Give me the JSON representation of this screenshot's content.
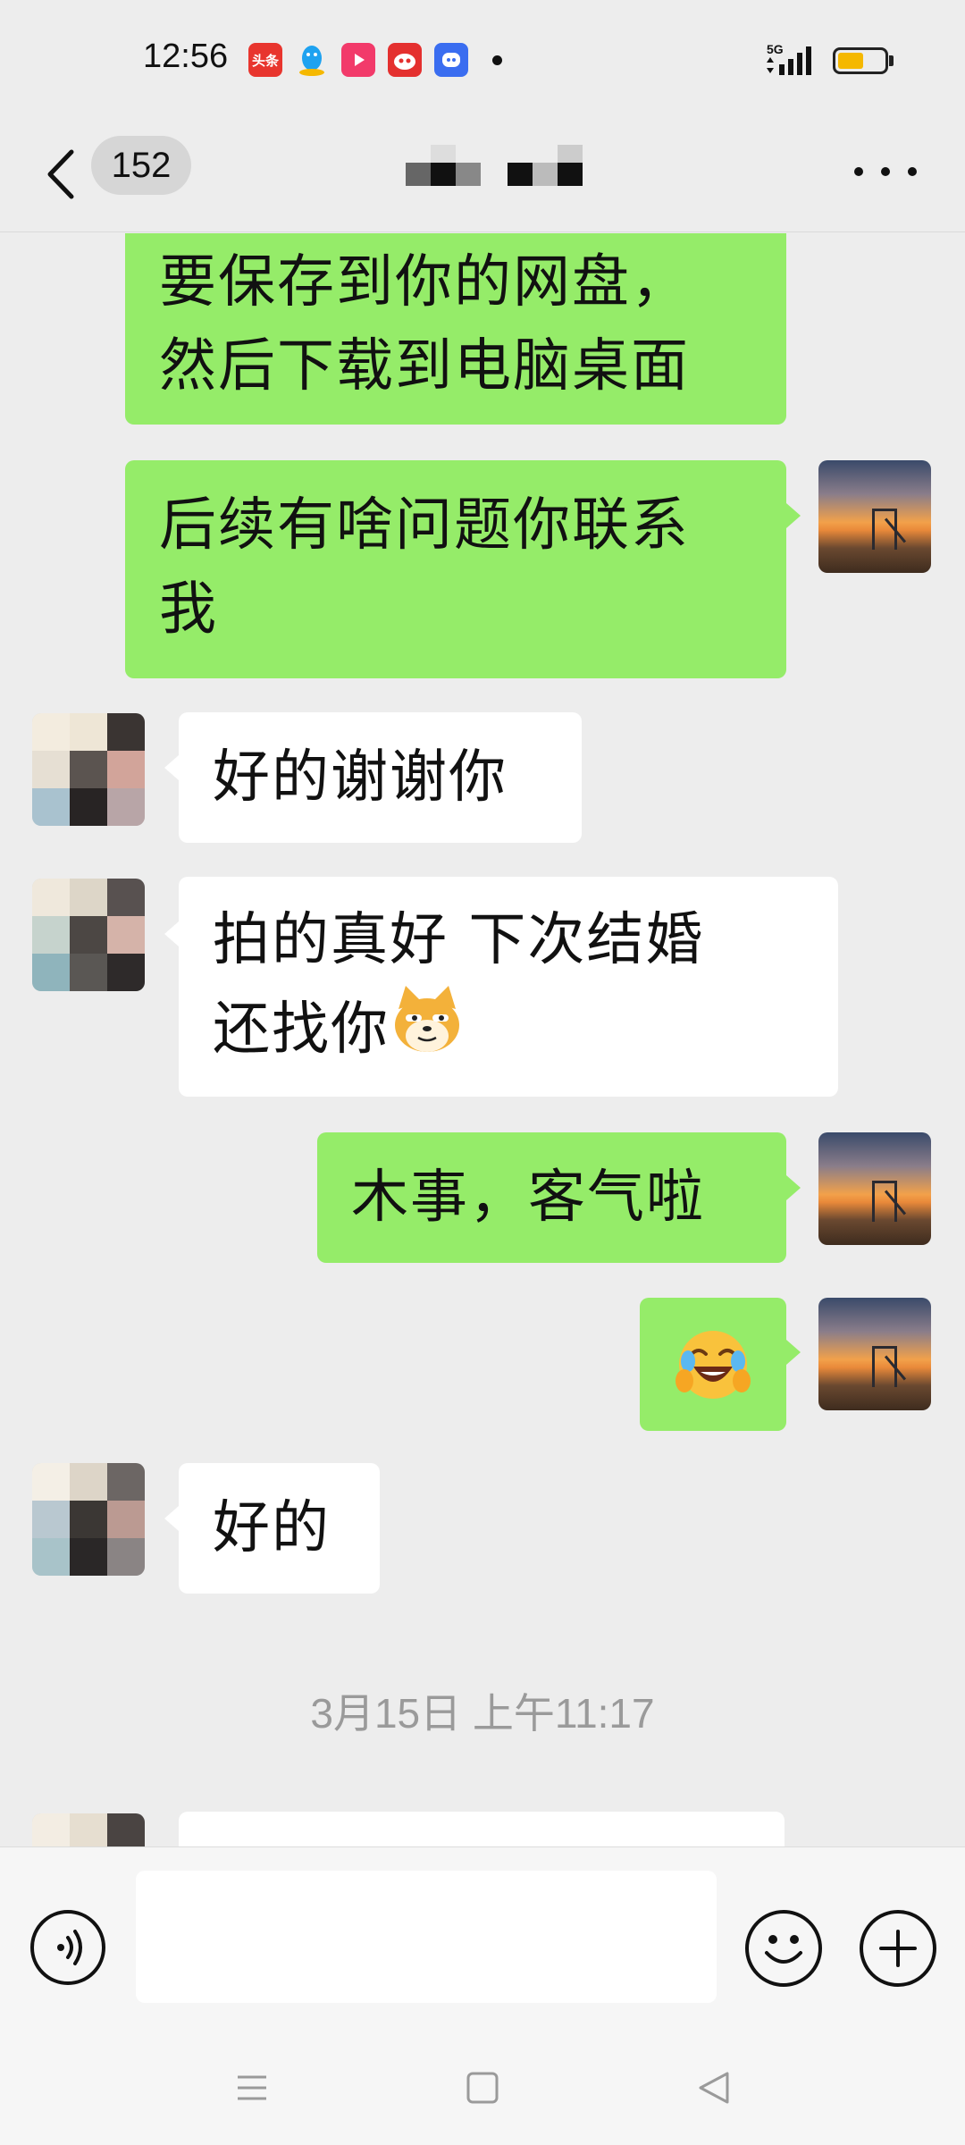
{
  "status_bar": {
    "time": "12:56",
    "app_icons": [
      {
        "name": "toutiao-icon",
        "label": "头条",
        "color": "#e8352e"
      },
      {
        "name": "qq-icon",
        "label": "",
        "color": "#1ea2f0"
      },
      {
        "name": "video-icon",
        "label": "",
        "color": "#f23a6a"
      },
      {
        "name": "robot-icon",
        "label": "",
        "color": "#e4302f"
      },
      {
        "name": "chat-bot-icon",
        "label": "",
        "color": "#3a6df0"
      }
    ],
    "network": "5G",
    "battery_level": 0.55,
    "battery_color": "#f5b800"
  },
  "header": {
    "back_icon": "chevron-left-icon",
    "unread_count": "152",
    "more_icon": "more-dots-icon"
  },
  "messages": [
    {
      "sender": "me",
      "text_lines": [
        "要保存到你的网盘，",
        "然后下载到电脑桌面"
      ]
    },
    {
      "sender": "me",
      "text_lines": [
        "后续有啥问题你联系",
        "我"
      ]
    },
    {
      "sender": "other",
      "text_lines": [
        "好的谢谢你"
      ]
    },
    {
      "sender": "other",
      "text_lines": [
        "拍的真好  下次结婚",
        "还找你"
      ],
      "trailing_emoji": "doge-cat-emoji"
    },
    {
      "sender": "me",
      "text_lines": [
        "木事，客气啦"
      ]
    },
    {
      "sender": "me",
      "emoji": "rolling-laughing-emoji"
    },
    {
      "sender": "other",
      "text_lines": [
        "好的"
      ]
    }
  ],
  "timestamp": "3月15日 上午11:17",
  "input_bar": {
    "voice_icon": "voice-icon",
    "input_value": "",
    "emoji_icon": "smiley-icon",
    "plus_icon": "plus-icon"
  },
  "nav_bar": {
    "menu_icon": "menu-icon",
    "home_icon": "home-icon",
    "back_icon": "back-triangle-icon"
  },
  "colors": {
    "my_bubble": "#95ec69",
    "other_bubble": "#ffffff",
    "background": "#ededed"
  }
}
